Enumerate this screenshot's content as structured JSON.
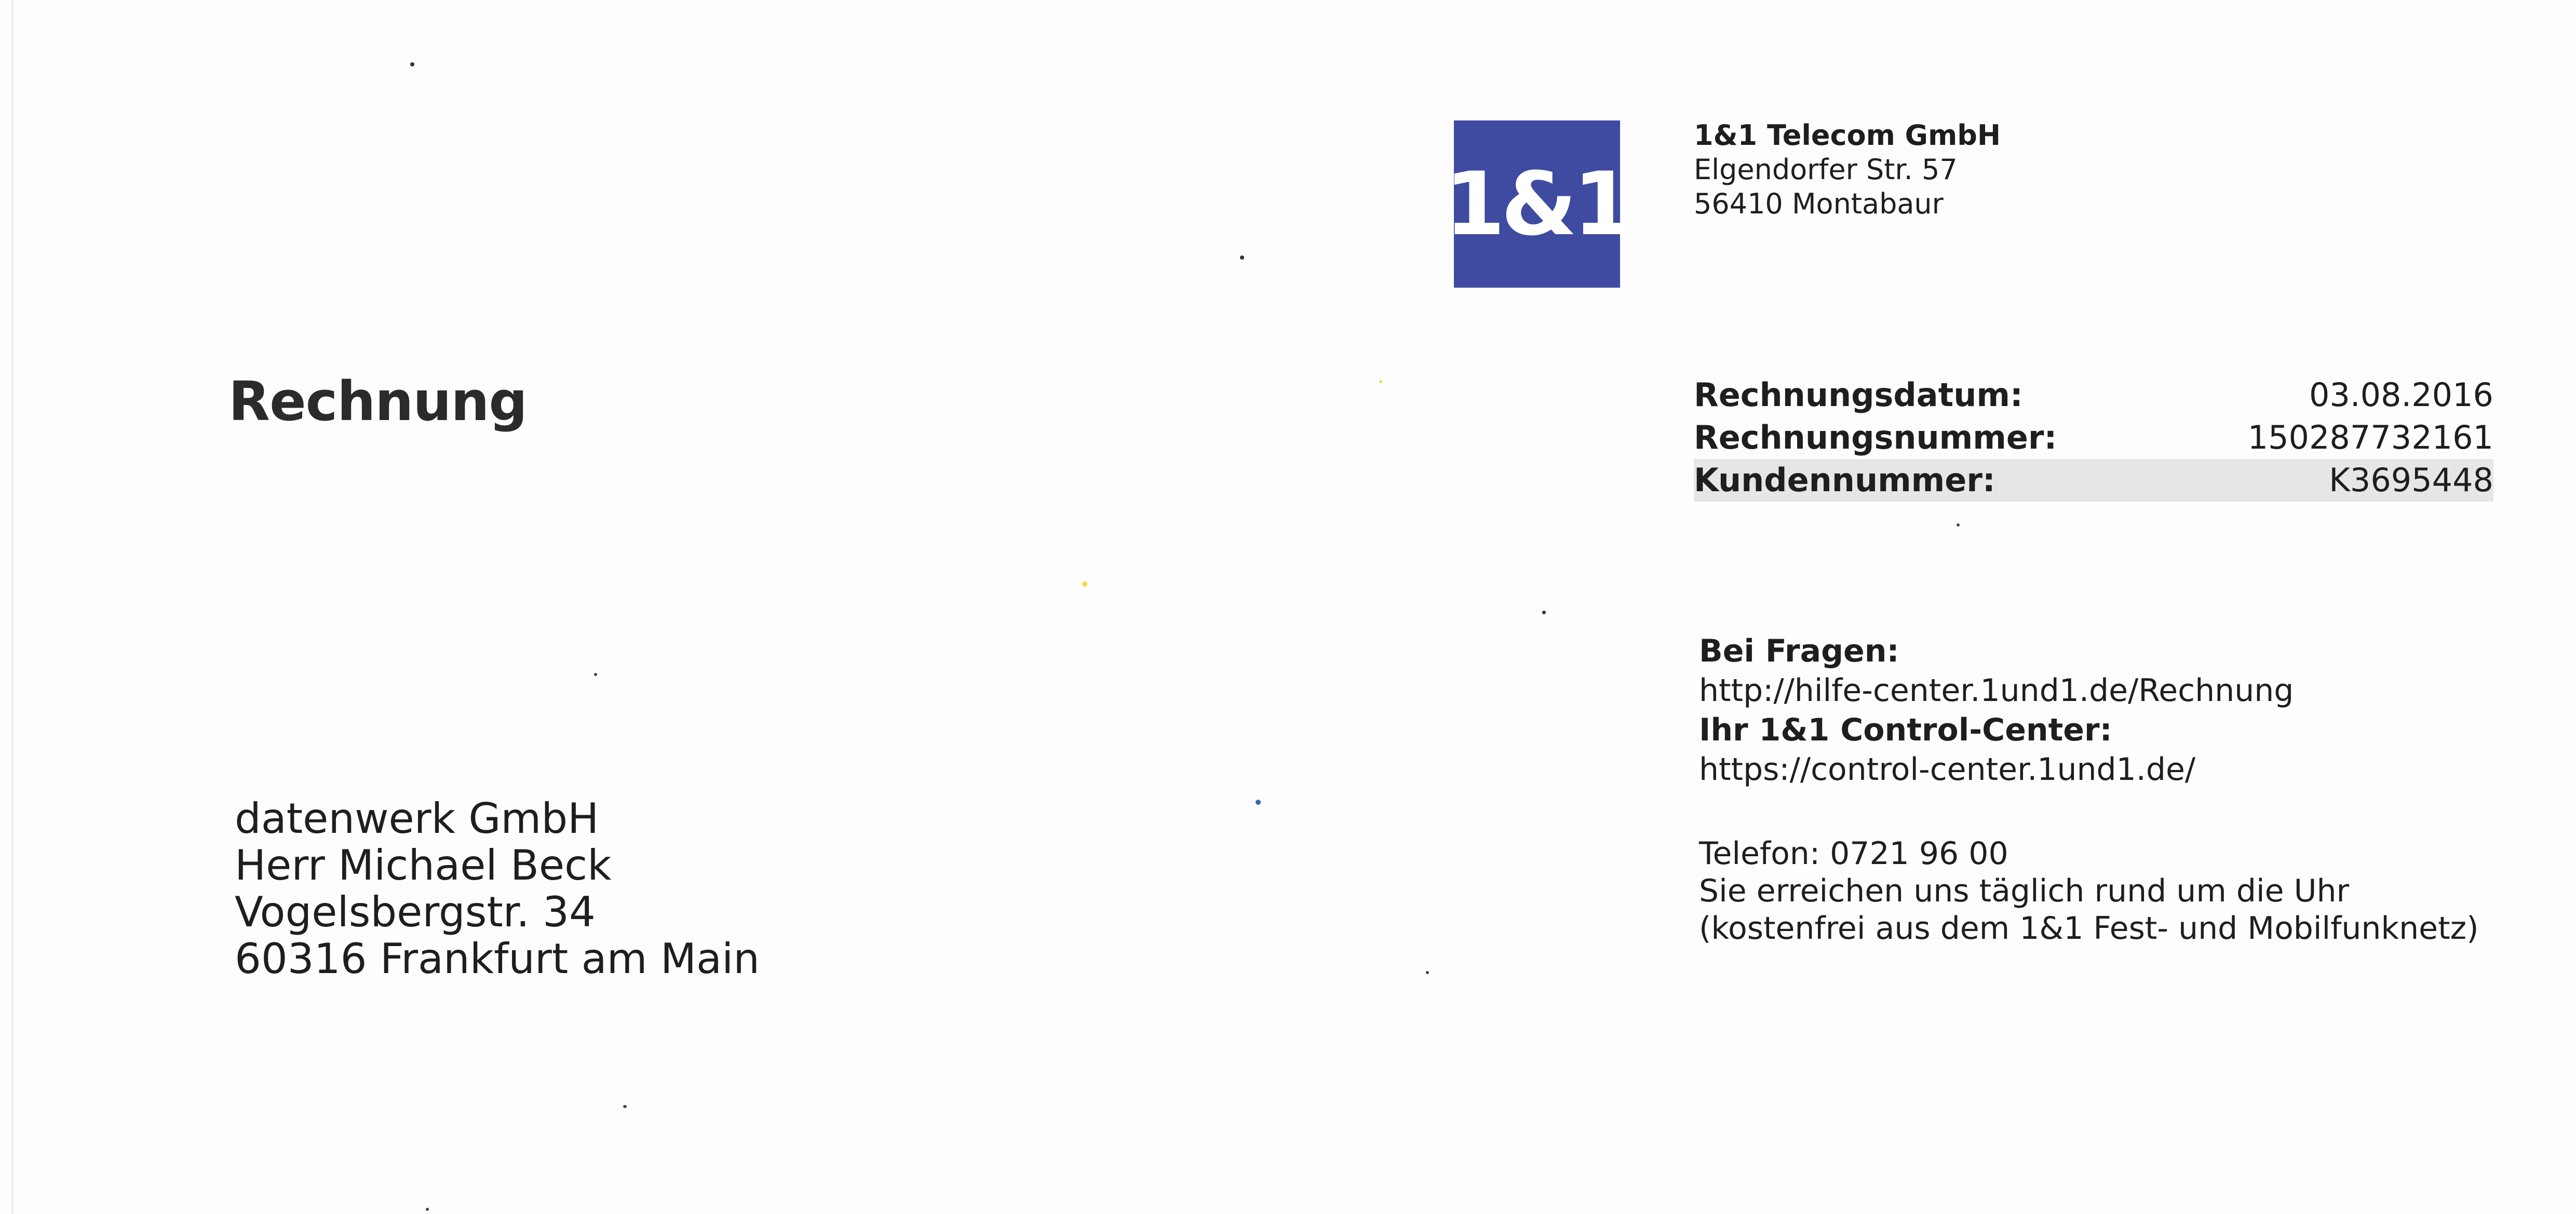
{
  "logo": {
    "text": "1&1",
    "color": "#3f4ba1"
  },
  "sender": {
    "company": "1&1 Telecom GmbH",
    "street": "Elgendorfer Str. 57",
    "city": "56410 Montabaur"
  },
  "document": {
    "title": "Rechnung"
  },
  "invoice_meta": [
    {
      "label": "Rechnungsdatum:",
      "value": "03.08.2016"
    },
    {
      "label": "Rechnungsnummer:",
      "value": "150287732161"
    },
    {
      "label": "Kundennummer:",
      "value": "K3695448"
    }
  ],
  "help": {
    "questions_label": "Bei Fragen:",
    "questions_url": "http://hilfe-center.1und1.de/Rechnung",
    "control_center_label": "Ihr 1&1 Control-Center:",
    "control_center_url": "https://control-center.1und1.de/"
  },
  "contact": {
    "phone": "Telefon: 0721 96 00",
    "availability": "Sie erreichen uns täglich rund um die Uhr",
    "note": "(kostenfrei aus dem 1&1 Fest- und Mobilfunknetz)"
  },
  "recipient": {
    "company": "datenwerk GmbH",
    "name": "Herr Michael Beck",
    "street": "Vogelsbergstr. 34",
    "city": "60316 Frankfurt am Main"
  }
}
